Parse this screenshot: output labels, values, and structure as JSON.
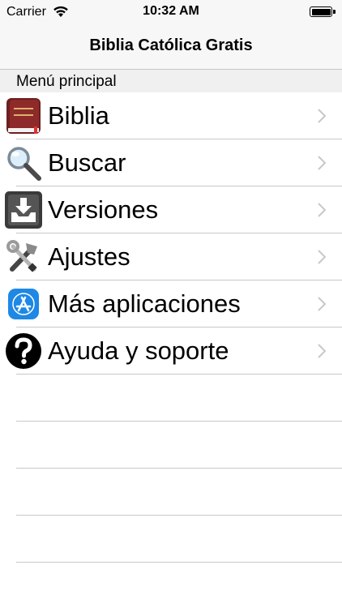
{
  "status_bar": {
    "carrier": "Carrier",
    "time": "10:32 AM"
  },
  "nav": {
    "title": "Biblia Católica Gratis"
  },
  "section": {
    "title": "Menú principal"
  },
  "menu": {
    "items": [
      {
        "label": "Biblia",
        "icon": "bible-book-icon"
      },
      {
        "label": "Buscar",
        "icon": "magnifier-icon"
      },
      {
        "label": "Versiones",
        "icon": "download-tray-icon"
      },
      {
        "label": "Ajustes",
        "icon": "tools-icon"
      },
      {
        "label": "Más aplicaciones",
        "icon": "app-store-icon"
      },
      {
        "label": "Ayuda y soporte",
        "icon": "help-question-icon"
      }
    ]
  },
  "colors": {
    "separator": "#c8c7cc",
    "chevron": "#c7c7cc",
    "appstore_blue": "#1e88e5"
  }
}
